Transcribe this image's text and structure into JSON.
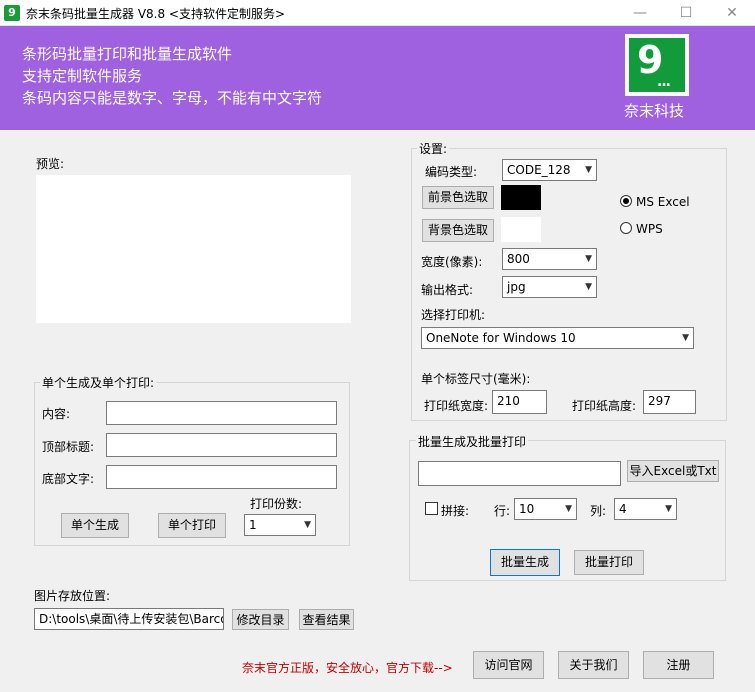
{
  "window": {
    "icon_glyph": "9",
    "title": "奈末条码批量生成器 V8.8  <支持软件定制服务>",
    "minimize": "—",
    "maximize": "☐",
    "close": "✕"
  },
  "banner": {
    "lines": [
      "条形码批量打印和批量生成软件",
      "支持定制软件服务",
      "条码内容只能是数字、字母，不能有中文字符"
    ],
    "logo_digit": "9",
    "logo_dots": "...",
    "logo_caption": "奈末科技"
  },
  "preview": {
    "label": "预览:"
  },
  "single": {
    "group_title": "单个生成及单个打印:",
    "content_label": "内容:",
    "top_title_label": "顶部标题:",
    "bottom_text_label": "底部文字:",
    "content_value": "",
    "top_title_value": "",
    "bottom_text_value": "",
    "copies_label": "打印份数:",
    "copies_value": "1",
    "generate_button": "单个生成",
    "print_button": "单个打印"
  },
  "save": {
    "label": "图片存放位置:",
    "path": "D:\\tools\\桌面\\待上传安装包\\Barco",
    "change_button": "修改目录",
    "view_button": "查看结果"
  },
  "settings": {
    "group_title": "设置:",
    "encoding_label": "编码类型:",
    "encoding_value": "CODE_128",
    "fg_button": "前景色选取",
    "bg_button": "背景色选取",
    "fg_color": "#000000",
    "bg_color": "#ffffff",
    "radio_excel": "MS  Excel",
    "radio_wps": "WPS",
    "width_label": "宽度(像素):",
    "width_value": "800",
    "format_label": "输出格式:",
    "format_value": "jpg",
    "printer_label": "选择打印机:",
    "printer_value": "OneNote for Windows 10",
    "size_label": "单个标签尺寸(毫米):",
    "paper_width_label": "打印纸宽度:",
    "paper_width_value": "210",
    "paper_height_label": "打印纸高度:",
    "paper_height_value": "297"
  },
  "batch": {
    "group_title": "批量生成及批量打印",
    "file_value": "",
    "import_button": "导入Excel或Txt",
    "join_label": "拼接:",
    "row_label": "行:",
    "row_value": "10",
    "col_label": "列:",
    "col_value": "4",
    "generate_button": "批量生成",
    "print_button": "批量打印"
  },
  "footer": {
    "notice": "奈末官方正版，安全放心，官方下载-->",
    "visit_button": "访问官网",
    "about_button": "关于我们",
    "register_button": "注册",
    "notice_color": "#c00000"
  },
  "colors": {
    "banner": "#a061e1",
    "logo": "#119b3b"
  }
}
